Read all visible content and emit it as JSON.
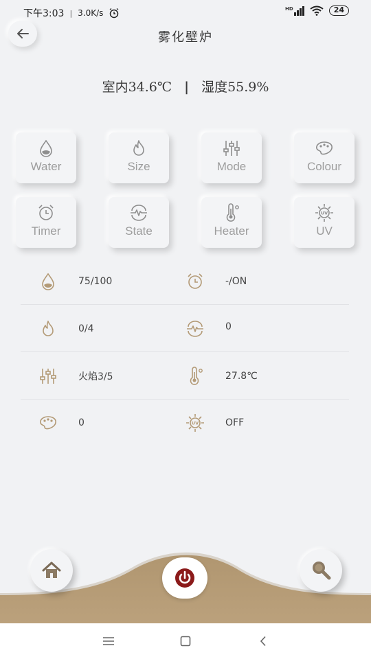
{
  "status_bar": {
    "time": "下午3:03",
    "separator": "|",
    "speed": "3.0K/s",
    "network": "HD",
    "battery": "24"
  },
  "header": {
    "title": "雾化壁炉"
  },
  "environment": {
    "indoor": "室内34.6℃",
    "divider": "|",
    "humidity": "湿度55.9%"
  },
  "tiles": [
    {
      "label": "Water",
      "icon": "water-drop-icon"
    },
    {
      "label": "Size",
      "icon": "flame-icon"
    },
    {
      "label": "Mode",
      "icon": "sliders-icon"
    },
    {
      "label": "Colour",
      "icon": "palette-icon"
    },
    {
      "label": "Timer",
      "icon": "alarm-clock-icon"
    },
    {
      "label": "State",
      "icon": "pulse-icon"
    },
    {
      "label": "Heater",
      "icon": "thermometer-icon"
    },
    {
      "label": "UV",
      "icon": "uv-icon"
    }
  ],
  "info": [
    {
      "left_icon": "water-drop-icon",
      "left_value": "75/100",
      "right_icon": "alarm-clock-icon",
      "right_value": "-/ON"
    },
    {
      "left_icon": "flame-icon",
      "left_value": "0/4",
      "right_icon": "pulse-icon",
      "right_value": "0"
    },
    {
      "left_icon": "sliders-icon",
      "left_value": "火焰3/5",
      "right_icon": "thermometer-icon",
      "right_value": "27.8℃"
    },
    {
      "left_icon": "palette-icon",
      "left_value": "0",
      "right_icon": "uv-icon",
      "right_value": "OFF"
    }
  ],
  "bottom_bar": {
    "home_icon": "home-icon",
    "power_icon": "power-icon",
    "search_icon": "search-icon"
  },
  "colors": {
    "accent": "#b39a76",
    "tile_label": "#9d9d9d",
    "power": "#8b1a1a",
    "background": "#f1f2f4"
  }
}
